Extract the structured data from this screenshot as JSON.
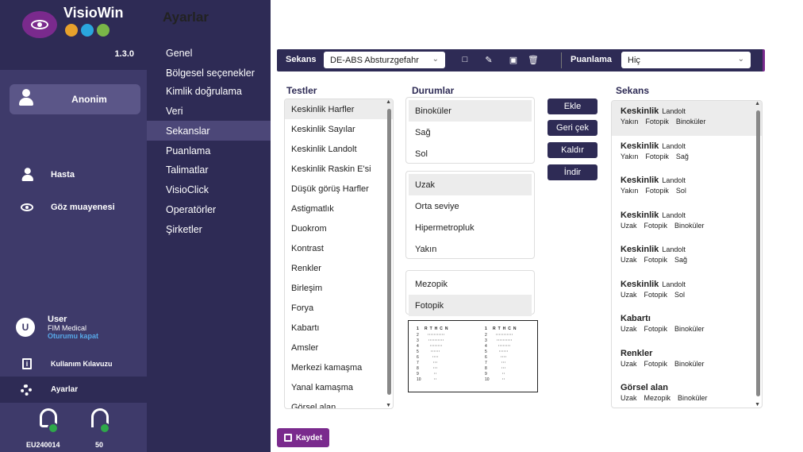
{
  "app": {
    "title": "VisioWin",
    "version": "1.3.0"
  },
  "page": {
    "title": "Ayarlar"
  },
  "profile": {
    "name": "Anonim"
  },
  "left_nav": [
    {
      "label": "Hasta"
    },
    {
      "label": "Göz muayenesi"
    }
  ],
  "user": {
    "initial": "U",
    "name": "User",
    "org": "FIM Medical",
    "logout": "Oturumu kapat"
  },
  "guide": {
    "label": "Kullanım Kılavuzu"
  },
  "settings": {
    "label": "Ayarlar"
  },
  "devices": [
    {
      "label": "EU240014"
    },
    {
      "label": "50"
    }
  ],
  "menu": [
    {
      "label": "Genel"
    },
    {
      "label": "Bölgesel seçenekler"
    },
    {
      "label": "Kimlik doğrulama"
    },
    {
      "label": "Veri"
    },
    {
      "label": "Sekanslar"
    },
    {
      "label": "Puanlama"
    },
    {
      "label": "Talimatlar"
    },
    {
      "label": "VisioClick"
    },
    {
      "label": "Operatörler"
    },
    {
      "label": "Şirketler"
    }
  ],
  "toolbar": {
    "sequence_label": "Sekans",
    "sequence_value": "DE-ABS Absturzgefahr",
    "scoring_label": "Puanlama",
    "scoring_value": "Hiç"
  },
  "columns": {
    "tests": "Testler",
    "conditions": "Durumlar",
    "sequence": "Sekans"
  },
  "tests": [
    "Keskinlik Harfler",
    "Keskinlik Sayılar",
    "Keskinlik Landolt",
    "Keskinlik Raskin E'si",
    "Düşük görüş Harfler",
    "Astigmatlık",
    "Duokrom",
    "Kontrast",
    "Renkler",
    "Birleşim",
    "Forya",
    "Kabartı",
    "Amsler",
    "Merkezi kamaşma",
    "Yanal kamaşma",
    "Görsel alan"
  ],
  "conditions": {
    "eyes": [
      "Binoküler",
      "Sağ",
      "Sol"
    ],
    "distance": [
      "Uzak",
      "Orta seviye",
      "Hipermetropluk",
      "Yakın"
    ],
    "lighting": [
      "Mezopik",
      "Fotopik"
    ]
  },
  "chart_preview": {
    "columns": [
      {
        "rows": [
          "1",
          "2",
          "3",
          "4",
          "5",
          "6",
          "7",
          "8",
          "9",
          "10"
        ],
        "letters": "RTHCN"
      },
      {
        "rows": [
          "1",
          "2",
          "3",
          "4",
          "5",
          "6",
          "7",
          "8",
          "9",
          "10"
        ],
        "letters": "RTHCN"
      }
    ]
  },
  "actions": [
    {
      "label": "Ekle"
    },
    {
      "label": "Geri çek"
    },
    {
      "label": "Kaldır"
    },
    {
      "label": "İndir"
    }
  ],
  "sequence": [
    {
      "title": "Keskinlik",
      "mod": "Landolt",
      "params": [
        "Yakın",
        "Fotopik",
        "Binoküler"
      ]
    },
    {
      "title": "Keskinlik",
      "mod": "Landolt",
      "params": [
        "Yakın",
        "Fotopik",
        "Sağ"
      ]
    },
    {
      "title": "Keskinlik",
      "mod": "Landolt",
      "params": [
        "Yakın",
        "Fotopik",
        "Sol"
      ]
    },
    {
      "title": "Keskinlik",
      "mod": "Landolt",
      "params": [
        "Uzak",
        "Fotopik",
        "Binoküler"
      ]
    },
    {
      "title": "Keskinlik",
      "mod": "Landolt",
      "params": [
        "Uzak",
        "Fotopik",
        "Sağ"
      ]
    },
    {
      "title": "Keskinlik",
      "mod": "Landolt",
      "params": [
        "Uzak",
        "Fotopik",
        "Sol"
      ]
    },
    {
      "title": "Kabartı",
      "mod": "",
      "params": [
        "Uzak",
        "Fotopik",
        "Binoküler"
      ]
    },
    {
      "title": "Renkler",
      "mod": "",
      "params": [
        "Uzak",
        "Fotopik",
        "Binoküler"
      ]
    },
    {
      "title": "Görsel alan",
      "mod": "",
      "params": [
        "Uzak",
        "Mezopik",
        "Binoküler"
      ]
    }
  ],
  "save": {
    "label": "Kaydet"
  },
  "colors": {
    "sidebar": "#3e3a6a",
    "sidebar_dark": "#2e2b55",
    "accent": "#7a2a8d",
    "link": "#57a8e8",
    "ok": "#2ea84a"
  }
}
